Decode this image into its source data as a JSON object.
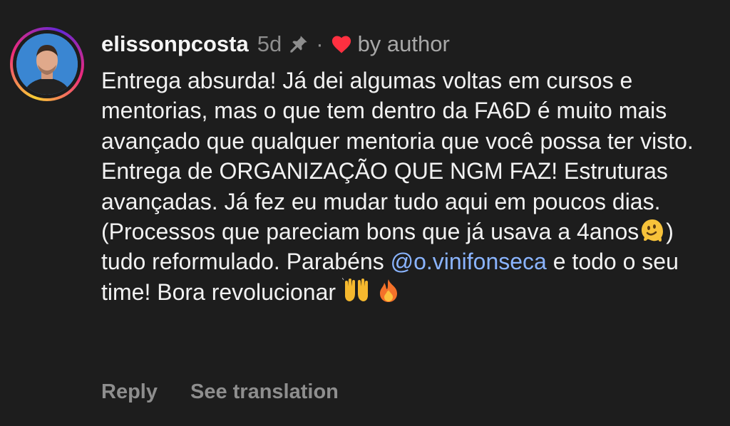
{
  "comment": {
    "username": "elissonpcosta",
    "time": "5d",
    "separator": "·",
    "liked_by": "by author",
    "text_parts": {
      "p1": "Entrega absurda! Já dei algumas voltas em cursos e mentorias, mas o que tem dentro da FA6D é muito mais avançado que qualquer mentoria que você possa ter visto. Entrega de ORGANIZAÇÃO QUE NGM FAZ! Estruturas avançadas. Já fez eu mudar tudo aqui em poucos dias. (Processos que pareciam bons que já usava a 4anos",
      "p2": ") tudo reformulado. Parabéns ",
      "mention": "@o.vinifonseca",
      "p3": " e todo o seu time! Bora revolucionar "
    },
    "icons": {
      "pin": "pin-icon",
      "heart": "heart-icon",
      "melting_face": "melting-face-emoji",
      "raised_hands": "raised-hands-emoji",
      "fire": "fire-emoji"
    },
    "colors": {
      "heart": "#ff3040",
      "mention": "#8ab4ff",
      "background": "#1d1d1d"
    }
  },
  "actions": {
    "reply": "Reply",
    "see_translation": "See translation"
  }
}
